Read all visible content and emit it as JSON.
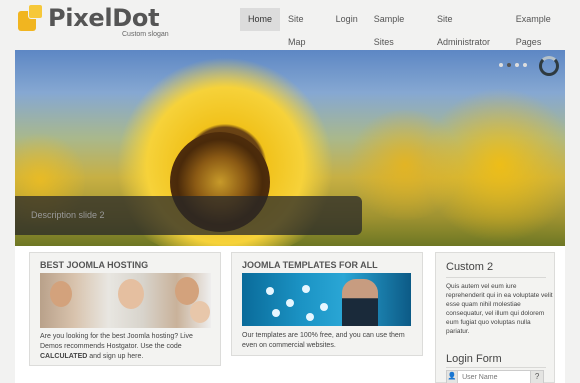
{
  "header": {
    "brand": "PixelDot",
    "slogan": "Custom slogan"
  },
  "nav": {
    "items": [
      {
        "label": "Home",
        "active": true
      },
      {
        "label": "Site Map"
      },
      {
        "label": "Login"
      },
      {
        "label": "Sample Sites"
      },
      {
        "label": "Site Administrator"
      },
      {
        "label": "Example Pages"
      }
    ]
  },
  "slider": {
    "caption": "Description slide 2",
    "dots": 4,
    "active_dot": 1
  },
  "modules": {
    "hosting": {
      "title": "BEST JOOMLA HOSTING",
      "text_before": "Are you looking for the best Joomla hosting? Live Demos recommends Hostgator. Use the code ",
      "code": "CALCULATED",
      "text_after": " and sign up here."
    },
    "templates": {
      "title": "JOOMLA TEMPLATES FOR ALL",
      "text": "Our templates are 100% free, and you can use them even on commercial websites."
    },
    "custom": {
      "title": "Custom 2",
      "text": "Quis autem vel eum iure reprehenderit qui in ea voluptate velit esse quam nihil molestiae consequatur, vel illum qui dolorem eum fugiat quo voluptas nulla pariatur."
    },
    "login": {
      "title": "Login Form",
      "username_placeholder": "User Name",
      "help": "?"
    }
  },
  "colors": {
    "logo_accent": "#f1b520",
    "nav_active_bg": "#dcdcdc"
  }
}
